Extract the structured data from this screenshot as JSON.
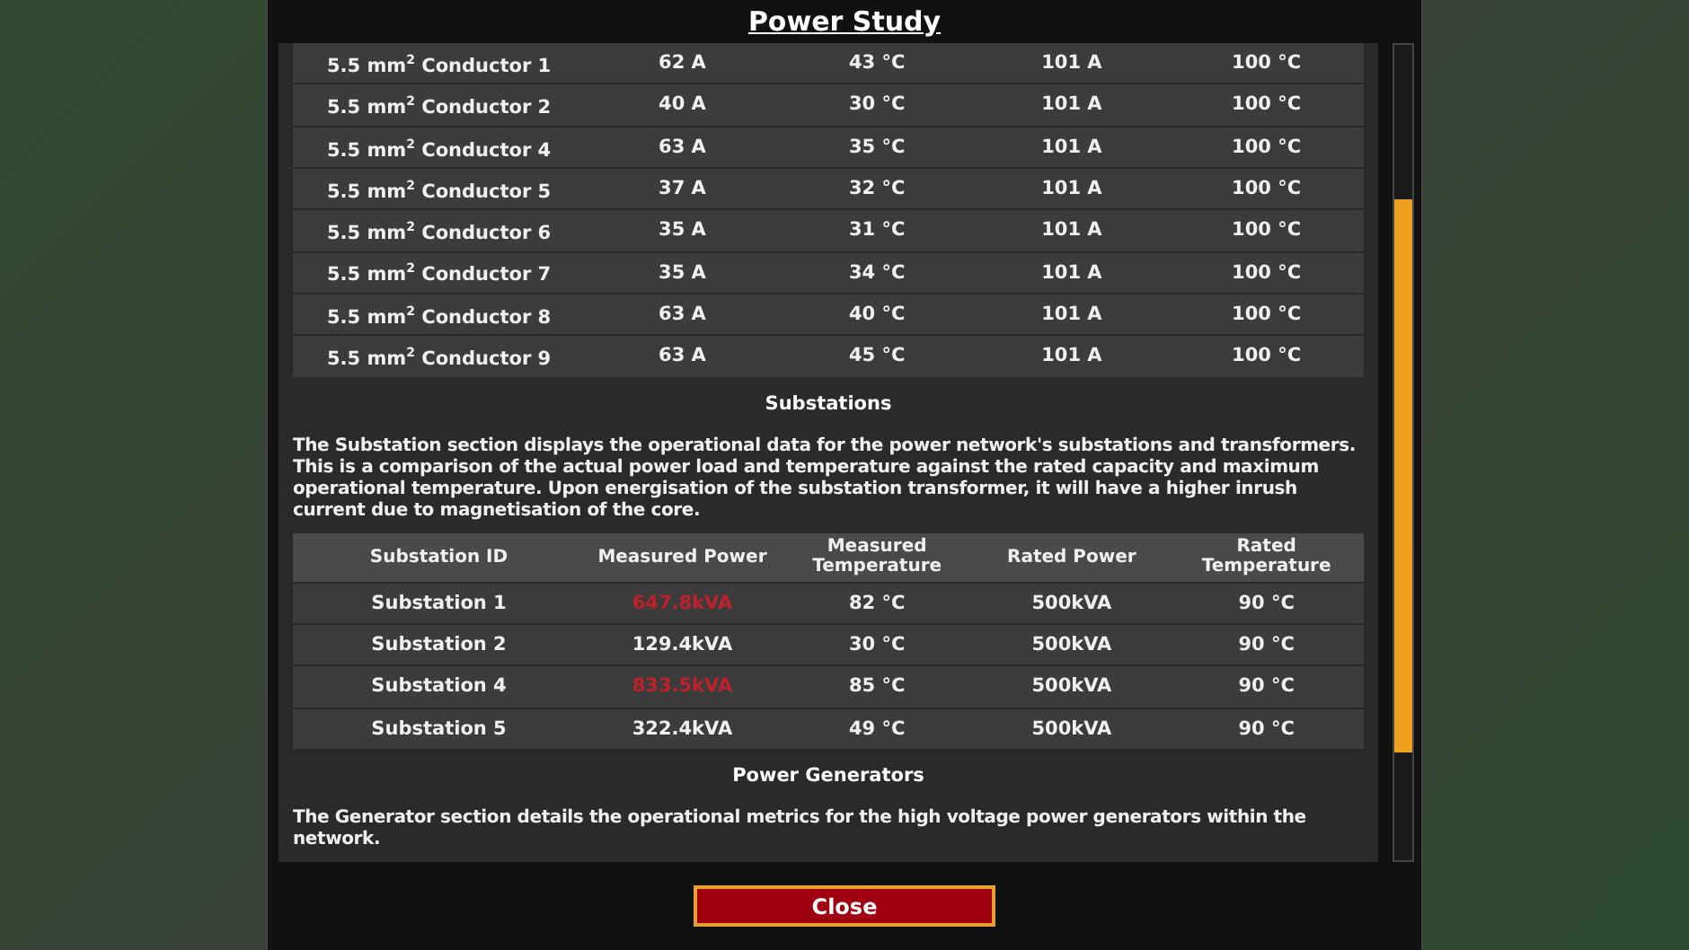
{
  "dialog": {
    "title": "Power Study"
  },
  "conductors": [
    {
      "cells": [
        "5.5 mm$^{2}$ Conductor 1",
        "62 A",
        "43 °C",
        "101 A",
        "100 °C"
      ]
    },
    {
      "cells": [
        "5.5 mm$^{2}$ Conductor 2",
        "40 A",
        "30 °C",
        "101 A",
        "100 °C"
      ]
    },
    {
      "cells": [
        "5.5 mm$^{2}$ Conductor 4",
        "63 A",
        "35 °C",
        "101 A",
        "100 °C"
      ]
    },
    {
      "cells": [
        "5.5 mm$^{2}$ Conductor 5",
        "37 A",
        "32 °C",
        "101 A",
        "100 °C"
      ]
    },
    {
      "cells": [
        "5.5 mm$^{2}$ Conductor 6",
        "35 A",
        "31 °C",
        "101 A",
        "100 °C"
      ]
    },
    {
      "cells": [
        "5.5 mm$^{2}$ Conductor 7",
        "35 A",
        "34 °C",
        "101 A",
        "100 °C"
      ]
    },
    {
      "cells": [
        "5.5 mm$^{2}$ Conductor 8",
        "63 A",
        "40 °C",
        "101 A",
        "100 °C"
      ]
    },
    {
      "cells": [
        "5.5 mm$^{2}$ Conductor 9",
        "63 A",
        "45 °C",
        "101 A",
        "100 °C"
      ]
    }
  ],
  "substations": {
    "heading": "Substations",
    "description": "The Substation section displays the operational data for the power network's substations and transformers. This is a comparison of the actual power load and temperature against the rated capacity and maximum operational temperature. Upon energisation of the substation transformer, it will have a higher inrush current due to magnetisation of the core.",
    "columns": [
      "Substation ID",
      "Measured Power",
      "Measured Temperature",
      "Rated Power",
      "Rated Temperature"
    ],
    "rows": [
      {
        "id": "Substation 1",
        "measured_power": "647.8kVA",
        "over_limit": true,
        "measured_temperature": "82 °C",
        "rated_power": "500kVA",
        "rated_temperature": "90 °C"
      },
      {
        "id": "Substation 2",
        "measured_power": "129.4kVA",
        "over_limit": false,
        "measured_temperature": "30 °C",
        "rated_power": "500kVA",
        "rated_temperature": "90 °C"
      },
      {
        "id": "Substation 4",
        "measured_power": "833.5kVA",
        "over_limit": true,
        "measured_temperature": "85 °C",
        "rated_power": "500kVA",
        "rated_temperature": "90 °C"
      },
      {
        "id": "Substation 5",
        "measured_power": "322.4kVA",
        "over_limit": false,
        "measured_temperature": "49 °C",
        "rated_power": "500kVA",
        "rated_temperature": "90 °C"
      }
    ]
  },
  "generators": {
    "heading": "Power Generators",
    "description": "The Generator section details the operational metrics for the high voltage power generators within the network."
  },
  "buttons": [
    {
      "label": "Close"
    }
  ]
}
